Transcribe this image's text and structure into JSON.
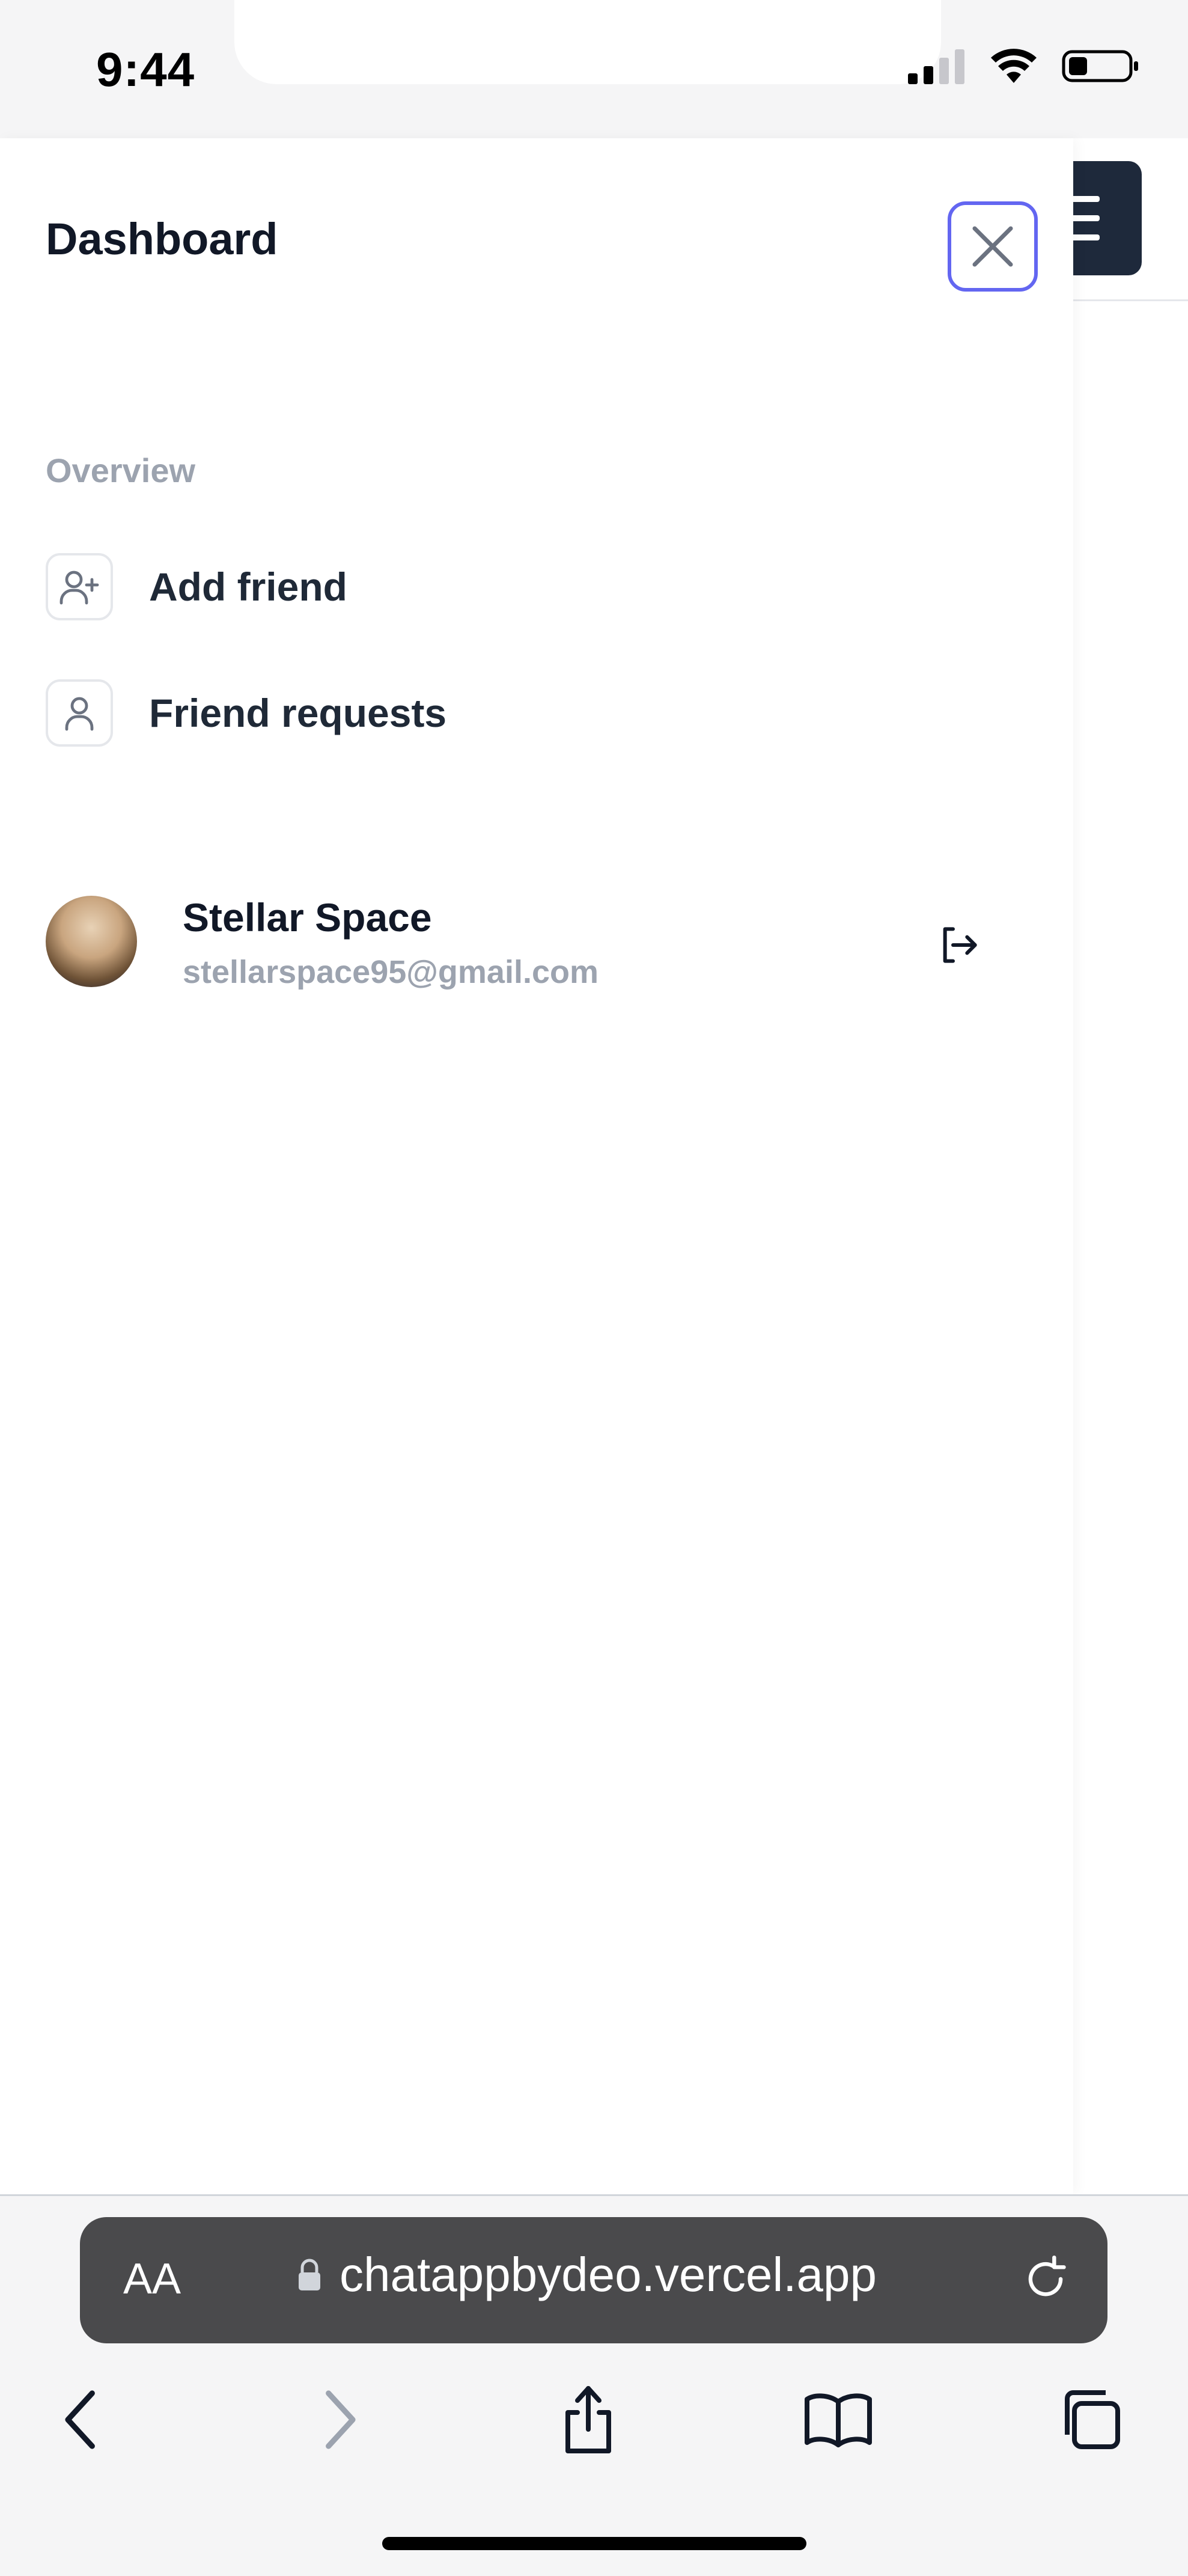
{
  "status_bar": {
    "time": "9:44"
  },
  "drawer": {
    "title": "Dashboard",
    "section_label": "Overview",
    "nav_items": [
      {
        "label": "Add friend",
        "icon": "user-plus-icon"
      },
      {
        "label": "Friend requests",
        "icon": "user-icon"
      }
    ],
    "profile": {
      "name": "Stellar Space",
      "email": "stellarspace95@gmail.com"
    }
  },
  "browser": {
    "text_size_label": "AA",
    "url": "chatappbydeo.vercel.app"
  },
  "colors": {
    "accent": "#6366f1",
    "menu_button": "#1e293b",
    "muted_text": "#9ca3af"
  }
}
